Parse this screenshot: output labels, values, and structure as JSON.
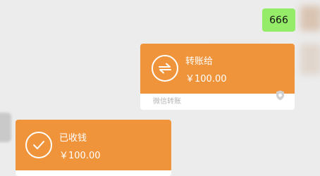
{
  "messages": [
    {
      "kind": "text",
      "side": "right",
      "text": "666"
    },
    {
      "kind": "transfer",
      "side": "right",
      "icon": "transfer-arrows-icon",
      "title": "转账给",
      "amount": "￥100.00",
      "footer": "微信转账"
    },
    {
      "kind": "transfer-received",
      "side": "left",
      "icon": "check-circle-icon",
      "title": "已收钱",
      "amount": "￥100.00"
    }
  ],
  "colors": {
    "background": "#ececec",
    "text_bubble": "#95ec69",
    "transfer_card": "#f0943b",
    "card_footer": "#ffffff"
  }
}
